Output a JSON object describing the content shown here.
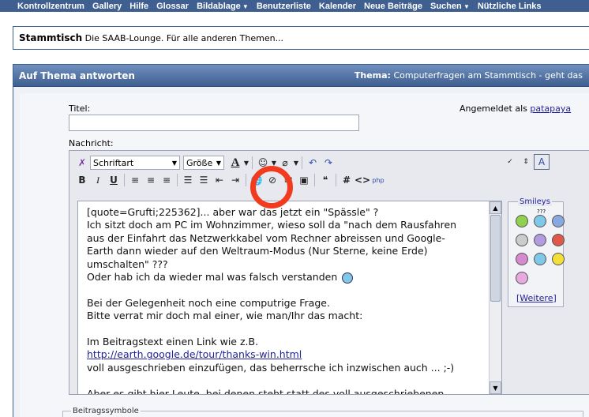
{
  "nav": {
    "items": [
      {
        "label": "Kontrollzentrum",
        "dropdown": false
      },
      {
        "label": "Gallery",
        "dropdown": false
      },
      {
        "label": "Hilfe",
        "dropdown": false
      },
      {
        "label": "Glossar",
        "dropdown": false
      },
      {
        "label": "Bildablage",
        "dropdown": true
      },
      {
        "label": "Benutzerliste",
        "dropdown": false
      },
      {
        "label": "Kalender",
        "dropdown": false
      },
      {
        "label": "Neue Beiträge",
        "dropdown": false
      },
      {
        "label": "Suchen",
        "dropdown": true
      },
      {
        "label": "Nützliche Links",
        "dropdown": false
      }
    ]
  },
  "forum": {
    "name": "Stammtisch",
    "description": "Die SAAB-Lounge. Für alle anderen Themen..."
  },
  "panel": {
    "title": "Auf Thema antworten",
    "thema_label": "Thema:",
    "thema_value": "Computerfragen am Stammtisch - geht das"
  },
  "form": {
    "title_label": "Titel:",
    "title_value": "",
    "message_label": "Nachricht:",
    "logged_in_prefix": "Angemeldet als",
    "username": "patapaya"
  },
  "toolbar": {
    "font_select": "Schriftart",
    "size_select": "Größe"
  },
  "message": {
    "lines": [
      "[quote=Grufti;225362]... aber war das jetzt ein \"Spässle\" ?",
      "Ich sitzt doch am PC im Wohnzimmer, wieso soll da \"nach dem Rausfahren",
      "aus der Einfahrt das Netzwerkkabel vom Rechner abreissen und Google-",
      "Earth dann wieder auf den Weltraum-Modus (Nur Sterne, keine Erde)",
      "umschalten\" ???",
      "Oder hab ich da wieder mal was falsch verstanden",
      "",
      "Bei der Gelegenheit noch eine computrige Frage.",
      "Bitte verrat mir doch mal einer, wie man/Ihr das macht:",
      "",
      "Im Beitragstext einen Link wie z.B.",
      "http://earth.google.de/tour/thanks-win.html",
      "voll ausgeschrieben einzufügen, das beherrsche ich inzwischen auch ... ;-)",
      "",
      "Aber es gibt hier Leute, bei denen steht statt des voll ausgeschriebenen"
    ],
    "link": "http://earth.google.de/tour/thanks-win.html"
  },
  "smilies": {
    "legend": "Smileys",
    "question_marks": "???",
    "more_label": "Weitere",
    "items": [
      {
        "name": "grin",
        "color": "#8fd14f"
      },
      {
        "name": "confused",
        "color": "#7fc8e8"
      },
      {
        "name": "cool",
        "color": "#8aa8e0"
      },
      {
        "name": "eek",
        "color": "#cccccc"
      },
      {
        "name": "frown",
        "color": "#b49be0"
      },
      {
        "name": "mad",
        "color": "#e0584a"
      },
      {
        "name": "biggrin",
        "color": "#d58ad0"
      },
      {
        "name": "rolleyes",
        "color": "#7fc8e8"
      },
      {
        "name": "smile",
        "color": "#f3de3a"
      },
      {
        "name": "tongue",
        "color": "#e8a9e0"
      }
    ]
  },
  "post_icons": {
    "legend": "Beitragssymbole"
  },
  "annotation": {
    "color": "#f23a1e"
  }
}
